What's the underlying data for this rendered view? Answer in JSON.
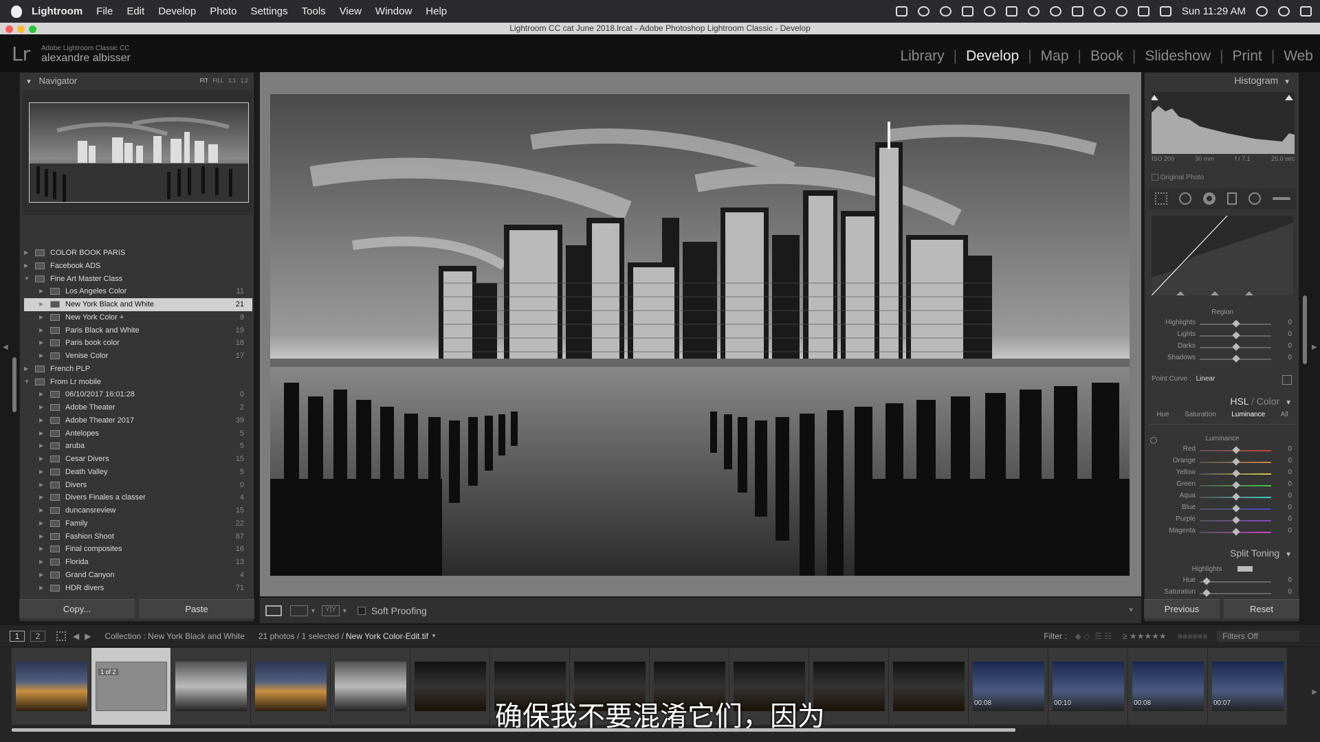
{
  "menubar": {
    "app": "Lightroom",
    "items": [
      "File",
      "Edit",
      "Develop",
      "Photo",
      "Settings",
      "Tools",
      "View",
      "Window",
      "Help"
    ],
    "clock": "Sun 11:29 AM"
  },
  "window": {
    "title": "Lightroom CC cat June 2018.lrcat - Adobe Photoshop Lightroom Classic - Develop"
  },
  "identity": {
    "logo": "Lr",
    "product": "Adobe Lightroom Classic CC",
    "user": "alexandre albisser"
  },
  "modules": [
    {
      "label": "Library",
      "active": false
    },
    {
      "label": "Develop",
      "active": true
    },
    {
      "label": "Map",
      "active": false
    },
    {
      "label": "Book",
      "active": false
    },
    {
      "label": "Slideshow",
      "active": false
    },
    {
      "label": "Print",
      "active": false
    },
    {
      "label": "Web",
      "active": false
    }
  ],
  "navigator": {
    "title": "Navigator",
    "zoom_options": [
      "FIT",
      "FILL",
      "1:1",
      "1:2"
    ]
  },
  "collections": [
    {
      "name": "COLOR BOOK PARIS",
      "count": "",
      "level": 0,
      "expanded": false,
      "selected": false
    },
    {
      "name": "Facebook ADS",
      "count": "",
      "level": 0,
      "expanded": false,
      "selected": false
    },
    {
      "name": "Fine Art Master Class",
      "count": "",
      "level": 0,
      "expanded": true,
      "selected": false
    },
    {
      "name": "Los Angeles Color",
      "count": "11",
      "level": 1,
      "expanded": false,
      "selected": false
    },
    {
      "name": "New York Black and White",
      "count": "21",
      "level": 1,
      "expanded": false,
      "selected": true
    },
    {
      "name": "New York Color +",
      "count": "9",
      "level": 1,
      "expanded": false,
      "selected": false
    },
    {
      "name": "Paris Black and White",
      "count": "19",
      "level": 1,
      "expanded": false,
      "selected": false
    },
    {
      "name": "Paris book color",
      "count": "18",
      "level": 1,
      "expanded": false,
      "selected": false
    },
    {
      "name": "Venise Color",
      "count": "17",
      "level": 1,
      "expanded": false,
      "selected": false
    },
    {
      "name": "French PLP",
      "count": "",
      "level": 0,
      "expanded": false,
      "selected": false
    },
    {
      "name": "From Lr mobile",
      "count": "",
      "level": 0,
      "expanded": true,
      "selected": false
    },
    {
      "name": "06/10/2017 16:01:28",
      "count": "0",
      "level": 1,
      "expanded": false,
      "selected": false
    },
    {
      "name": "Adobe Theater",
      "count": "2",
      "level": 1,
      "expanded": false,
      "selected": false
    },
    {
      "name": "Adobe Theater 2017",
      "count": "39",
      "level": 1,
      "expanded": false,
      "selected": false
    },
    {
      "name": "Antelopes",
      "count": "5",
      "level": 1,
      "expanded": false,
      "selected": false
    },
    {
      "name": "aruba",
      "count": "5",
      "level": 1,
      "expanded": false,
      "selected": false
    },
    {
      "name": "Cesar Divers",
      "count": "15",
      "level": 1,
      "expanded": false,
      "selected": false
    },
    {
      "name": "Death Valley",
      "count": "5",
      "level": 1,
      "expanded": false,
      "selected": false
    },
    {
      "name": "Divers",
      "count": "0",
      "level": 1,
      "expanded": false,
      "selected": false
    },
    {
      "name": "Divers Finales a classer",
      "count": "4",
      "level": 1,
      "expanded": false,
      "selected": false
    },
    {
      "name": "duncansreview",
      "count": "15",
      "level": 1,
      "expanded": false,
      "selected": false
    },
    {
      "name": "Family",
      "count": "22",
      "level": 1,
      "expanded": false,
      "selected": false
    },
    {
      "name": "Fashion Shoot",
      "count": "87",
      "level": 1,
      "expanded": false,
      "selected": false
    },
    {
      "name": "Final composites",
      "count": "16",
      "level": 1,
      "expanded": false,
      "selected": false
    },
    {
      "name": "Florida",
      "count": "13",
      "level": 1,
      "expanded": false,
      "selected": false
    },
    {
      "name": "Grand Canyon",
      "count": "4",
      "level": 1,
      "expanded": false,
      "selected": false
    },
    {
      "name": "HDR divers",
      "count": "71",
      "level": 1,
      "expanded": false,
      "selected": false
    }
  ],
  "left_buttons": {
    "copy": "Copy...",
    "paste": "Paste"
  },
  "toolbar": {
    "soft_proofing": "Soft Proofing"
  },
  "histogram": {
    "title": "Histogram",
    "iso": "ISO 200",
    "focal": "30 mm",
    "aperture": "f / 7.1",
    "shutter": "25.0 sec",
    "original_photo": "Original Photo"
  },
  "tone_curve": {
    "region_title": "Region",
    "sliders": [
      {
        "label": "Highlights",
        "value": "0"
      },
      {
        "label": "Lights",
        "value": "0"
      },
      {
        "label": "Darks",
        "value": "0"
      },
      {
        "label": "Shadows",
        "value": "0"
      }
    ],
    "point_curve_label": "Point Curve :",
    "point_curve_value": "Linear"
  },
  "hsl": {
    "title_hsl": "HSL",
    "title_sep": "/",
    "title_color": "Color",
    "tabs": [
      "Hue",
      "Saturation",
      "Luminance",
      "All"
    ],
    "active_tab": "Luminance",
    "group_title": "Luminance",
    "sliders": [
      {
        "label": "Red",
        "value": "0",
        "color": "#c44"
      },
      {
        "label": "Orange",
        "value": "0",
        "color": "#c84"
      },
      {
        "label": "Yellow",
        "value": "0",
        "color": "#cc4"
      },
      {
        "label": "Green",
        "value": "0",
        "color": "#4c4"
      },
      {
        "label": "Aqua",
        "value": "0",
        "color": "#4cc"
      },
      {
        "label": "Blue",
        "value": "0",
        "color": "#44c"
      },
      {
        "label": "Purple",
        "value": "0",
        "color": "#84c"
      },
      {
        "label": "Magenta",
        "value": "0",
        "color": "#c4c"
      }
    ]
  },
  "split_toning": {
    "title": "Split Toning",
    "highlights": "Highlights",
    "sliders": [
      {
        "label": "Hue",
        "value": "0"
      },
      {
        "label": "Saturation",
        "value": "0"
      }
    ]
  },
  "right_buttons": {
    "previous": "Previous",
    "reset": "Reset"
  },
  "filmstrip": {
    "screen1": "1",
    "screen2": "2",
    "collection": "Collection : New York Black and White",
    "photos": "21 photos / 1 selected /",
    "filename": "New York Color-Edit.tif",
    "filter_label": "Filter :",
    "filters_off": "Filters Off",
    "stack_badge": "1 of 2",
    "thumbs": [
      {
        "duration": "",
        "style": "warm"
      },
      {
        "duration": "",
        "style": "selected"
      },
      {
        "duration": "",
        "style": "bw"
      },
      {
        "duration": "",
        "style": "warm"
      },
      {
        "duration": "",
        "style": "bw"
      },
      {
        "duration": "",
        "style": "night"
      },
      {
        "duration": "",
        "style": "night"
      },
      {
        "duration": "",
        "style": "night"
      },
      {
        "duration": "",
        "style": "night"
      },
      {
        "duration": "",
        "style": "night"
      },
      {
        "duration": "",
        "style": "night"
      },
      {
        "duration": "",
        "style": "night"
      },
      {
        "duration": "00:08",
        "style": "blue"
      },
      {
        "duration": "00:10",
        "style": "blue"
      },
      {
        "duration": "00:08",
        "style": "blue"
      },
      {
        "duration": "00:07",
        "style": "blue"
      }
    ]
  },
  "subtitle": "确保我不要混淆它们，因为"
}
